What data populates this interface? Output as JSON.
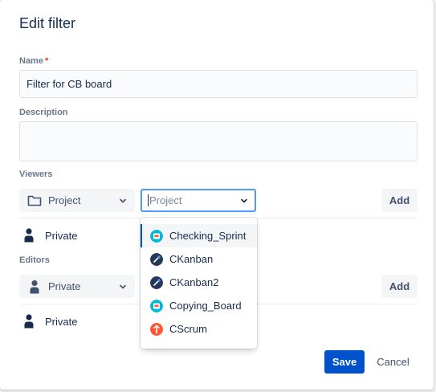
{
  "dialog": {
    "title": "Edit filter",
    "name_label": "Name",
    "required_mark": "*",
    "name_value": "Filter for CB board",
    "description_label": "Description",
    "description_value": "",
    "viewers_label": "Viewers",
    "editors_label": "Editors",
    "save_label": "Save",
    "cancel_label": "Cancel"
  },
  "viewers": {
    "type_select": {
      "label": "Project",
      "icon": "folder-icon"
    },
    "project_input": {
      "placeholder": "Project"
    },
    "add_label": "Add",
    "entries": [
      {
        "label": "Private",
        "icon": "person-icon"
      }
    ]
  },
  "editors": {
    "type_select": {
      "label": "Private",
      "icon": "person-icon"
    },
    "add_label": "Add",
    "entries": [
      {
        "label": "Private",
        "icon": "person-icon"
      }
    ]
  },
  "project_dropdown": {
    "options": [
      {
        "label": "Checking_Sprint",
        "icon": "project-avatar-cyan-icon",
        "selected": true
      },
      {
        "label": "CKanban",
        "icon": "project-avatar-rocket-icon",
        "selected": false
      },
      {
        "label": "CKanban2",
        "icon": "project-avatar-rocket-icon",
        "selected": false
      },
      {
        "label": "Copying_Board",
        "icon": "project-avatar-cyan-icon",
        "selected": false
      },
      {
        "label": "CScrum",
        "icon": "project-avatar-red-icon",
        "selected": false
      }
    ]
  },
  "colors": {
    "primary": "#0052cc",
    "focus_border": "#4c9aff",
    "required": "#de350b"
  }
}
